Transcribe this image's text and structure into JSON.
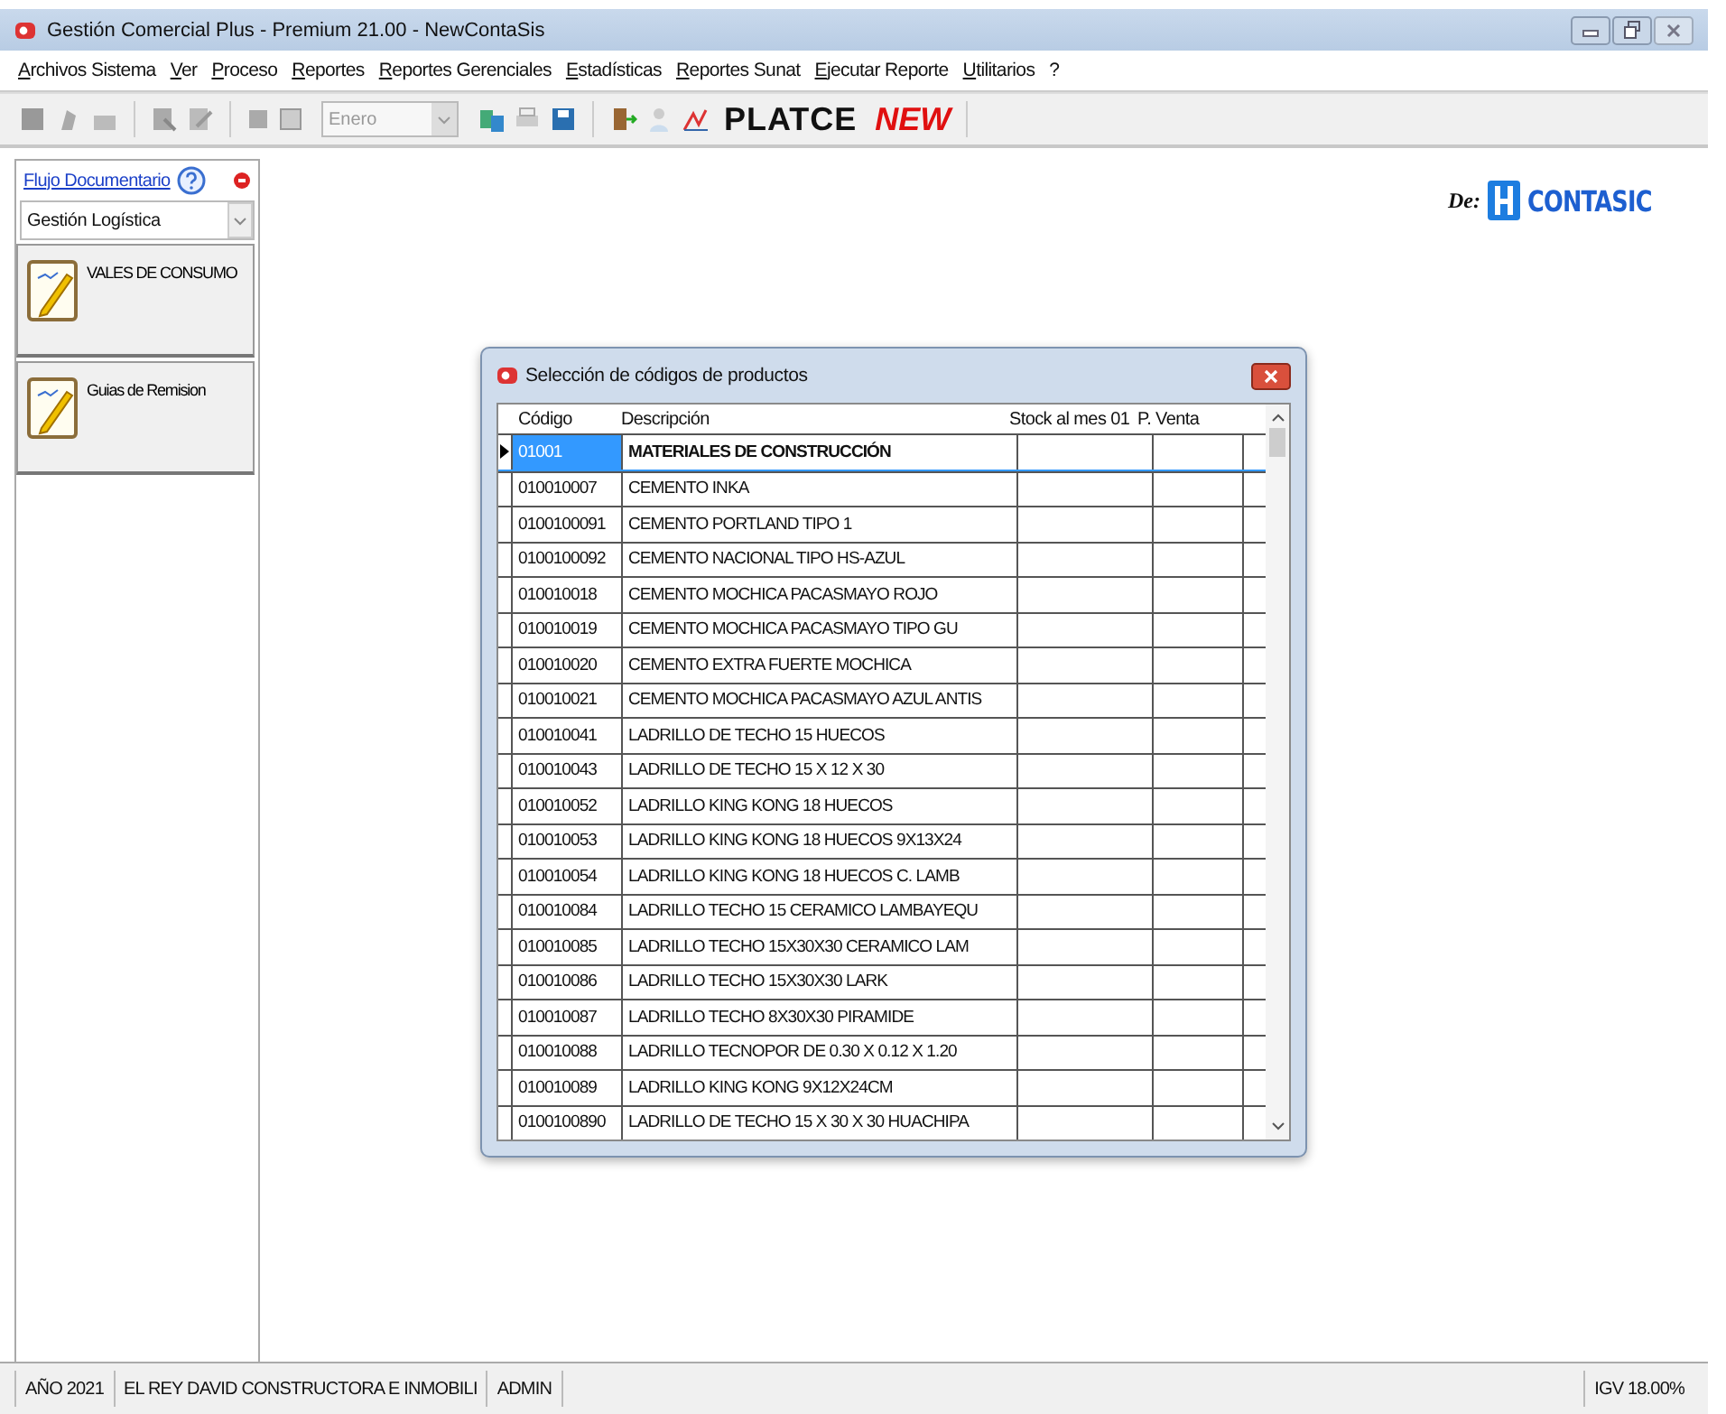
{
  "window": {
    "title": "Gestión Comercial Plus - Premium 21.00 - NewContaSis"
  },
  "menu": [
    "Archivos Sistema",
    "Ver",
    "Proceso",
    "Reportes",
    "Reportes Gerenciales",
    "Estadísticas",
    "Reportes Sunat",
    "Ejecutar Reporte",
    "Utilitarios",
    "?"
  ],
  "toolbar": {
    "month_select": {
      "value": "Enero",
      "disabled": true
    },
    "brand": "PLATCE",
    "brand_tag": "NEW"
  },
  "sidebar": {
    "link": "Flujo Documentario",
    "module_select": {
      "value": "Gestión Logística"
    },
    "items": [
      {
        "label": "VALES DE CONSUMO"
      },
      {
        "label": "Guias de Remision"
      }
    ]
  },
  "logo": {
    "prefix": "De:",
    "name": "CONTASIC"
  },
  "dialog": {
    "title": "Selección de códigos de productos",
    "table": {
      "columns": [
        "Código",
        "Descripción",
        "Stock al mes 01",
        "P. Venta"
      ],
      "rows": [
        {
          "cells": [
            "01001",
            "MATERIALES DE CONSTRUCCIÓN",
            "",
            ""
          ],
          "kind": "group",
          "selected": true
        },
        {
          "cells": [
            "010010007",
            "CEMENTO INKA",
            "",
            ""
          ],
          "kind": "item",
          "selected": false
        },
        {
          "cells": [
            "0100100091",
            "CEMENTO PORTLAND TIPO 1",
            "",
            ""
          ],
          "kind": "item",
          "selected": false
        },
        {
          "cells": [
            "0100100092",
            "CEMENTO NACIONAL TIPO HS-AZUL",
            "",
            ""
          ],
          "kind": "item",
          "selected": false
        },
        {
          "cells": [
            "010010018",
            "CEMENTO MOCHICA PACASMAYO ROJO",
            "",
            ""
          ],
          "kind": "item",
          "selected": false
        },
        {
          "cells": [
            "010010019",
            "CEMENTO MOCHICA PACASMAYO TIPO GU",
            "",
            ""
          ],
          "kind": "item",
          "selected": false
        },
        {
          "cells": [
            "010010020",
            "CEMENTO EXTRA FUERTE MOCHICA",
            "",
            ""
          ],
          "kind": "item",
          "selected": false
        },
        {
          "cells": [
            "010010021",
            "CEMENTO MOCHICA PACASMAYO AZUL ANTIS",
            "",
            ""
          ],
          "kind": "item",
          "selected": false
        },
        {
          "cells": [
            "010010041",
            "LADRILLO DE TECHO 15 HUECOS",
            "",
            ""
          ],
          "kind": "item",
          "selected": false
        },
        {
          "cells": [
            "010010043",
            "LADRILLO DE TECHO 15 X 12 X 30",
            "",
            ""
          ],
          "kind": "item",
          "selected": false
        },
        {
          "cells": [
            "010010052",
            "LADRILLO KING KONG 18 HUECOS",
            "",
            ""
          ],
          "kind": "item",
          "selected": false
        },
        {
          "cells": [
            "010010053",
            "LADRILLO KING KONG 18 HUECOS  9X13X24",
            "",
            ""
          ],
          "kind": "item",
          "selected": false
        },
        {
          "cells": [
            "010010054",
            "LADRILLO KING KONG 18 HUECOS C. LAMB",
            "",
            ""
          ],
          "kind": "item",
          "selected": false
        },
        {
          "cells": [
            "010010084",
            "LADRILLO TECHO 15 CERAMICO LAMBAYEQU",
            "",
            ""
          ],
          "kind": "item",
          "selected": false
        },
        {
          "cells": [
            "010010085",
            "LADRILLO TECHO 15X30X30 CERAMICO LAM",
            "",
            ""
          ],
          "kind": "item",
          "selected": false
        },
        {
          "cells": [
            "010010086",
            "LADRILLO TECHO 15X30X30 LARK",
            "",
            ""
          ],
          "kind": "item",
          "selected": false
        },
        {
          "cells": [
            "010010087",
            "LADRILLO TECHO 8X30X30 PIRAMIDE",
            "",
            ""
          ],
          "kind": "item",
          "selected": false
        },
        {
          "cells": [
            "010010088",
            "LADRILLO TECNOPOR DE 0.30 X 0.12 X 1.20",
            "",
            ""
          ],
          "kind": "item",
          "selected": false
        },
        {
          "cells": [
            "010010089",
            "LADRILLO KING KONG 9X12X24CM",
            "",
            ""
          ],
          "kind": "item",
          "selected": false
        },
        {
          "cells": [
            "0100100890",
            "LADRILLO DE TECHO 15 X 30 X 30 HUACHIPA",
            "",
            ""
          ],
          "kind": "item",
          "selected": false
        }
      ]
    }
  },
  "status_bar": [
    "AÑO 2021",
    "EL REY DAVID CONSTRUCTORA E INMOBILI",
    "ADMIN",
    "IGV 18.00%"
  ]
}
